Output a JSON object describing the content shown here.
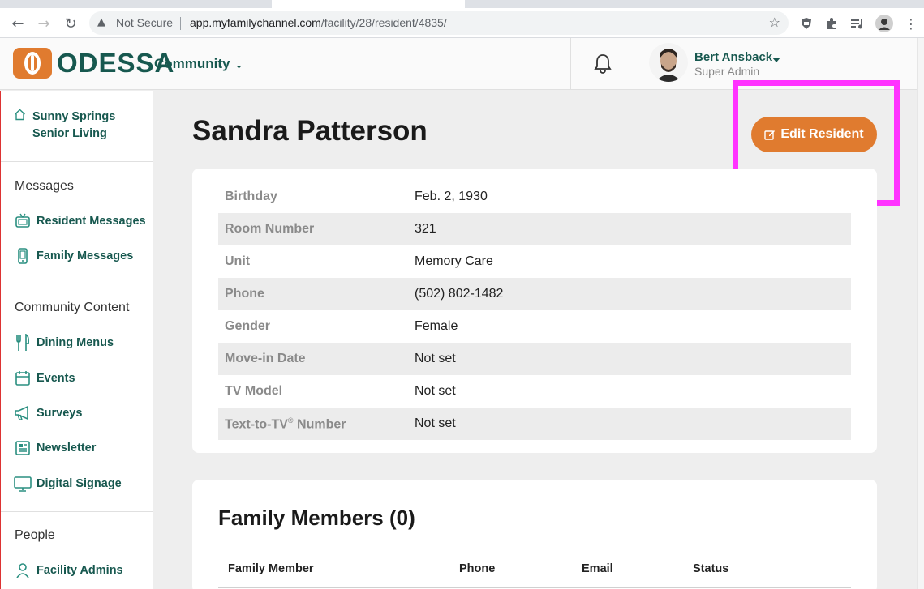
{
  "browser": {
    "security_label": "Not Secure",
    "url_host": "app.myfamilychannel.com",
    "url_path": "/facility/28/resident/4835/"
  },
  "header": {
    "brand": "ODESSA",
    "community_label": "Community",
    "user": {
      "name": "Bert Ansback",
      "role": "Super Admin"
    }
  },
  "sidebar": {
    "facility": "Sunny Springs Senior Living",
    "sections": [
      {
        "heading": "Messages",
        "items": [
          {
            "label": "Resident Messages",
            "icon": "tv-icon"
          },
          {
            "label": "Family Messages",
            "icon": "phone-icon"
          }
        ]
      },
      {
        "heading": "Community Content",
        "items": [
          {
            "label": "Dining Menus",
            "icon": "utensils-icon"
          },
          {
            "label": "Events",
            "icon": "calendar-icon"
          },
          {
            "label": "Surveys",
            "icon": "megaphone-icon"
          },
          {
            "label": "Newsletter",
            "icon": "newspaper-icon"
          },
          {
            "label": "Digital Signage",
            "icon": "monitor-icon"
          }
        ]
      },
      {
        "heading": "People",
        "items": [
          {
            "label": "Facility Admins",
            "icon": "person-icon"
          }
        ]
      }
    ]
  },
  "main": {
    "title": "Sandra Patterson",
    "edit_button": "Edit Resident",
    "details": [
      {
        "key": "Birthday",
        "value": "Feb. 2, 1930"
      },
      {
        "key": "Room Number",
        "value": "321"
      },
      {
        "key": "Unit",
        "value": "Memory Care"
      },
      {
        "key": "Phone",
        "value": "(502) 802-1482"
      },
      {
        "key": "Gender",
        "value": "Female"
      },
      {
        "key": "Move-in Date",
        "value": "Not set"
      },
      {
        "key": "TV Model",
        "value": "Not set"
      },
      {
        "key": "Text-to-TV",
        "key_sup": "®",
        "key_suffix": " Number",
        "value": "Not set"
      }
    ],
    "family": {
      "title": "Family Members (0)",
      "columns": [
        "Family Member",
        "Phone",
        "Email",
        "Status"
      ]
    }
  },
  "colors": {
    "brand_green": "#17584f",
    "accent_orange": "#e07b2f",
    "highlight": "#ff33ff"
  }
}
